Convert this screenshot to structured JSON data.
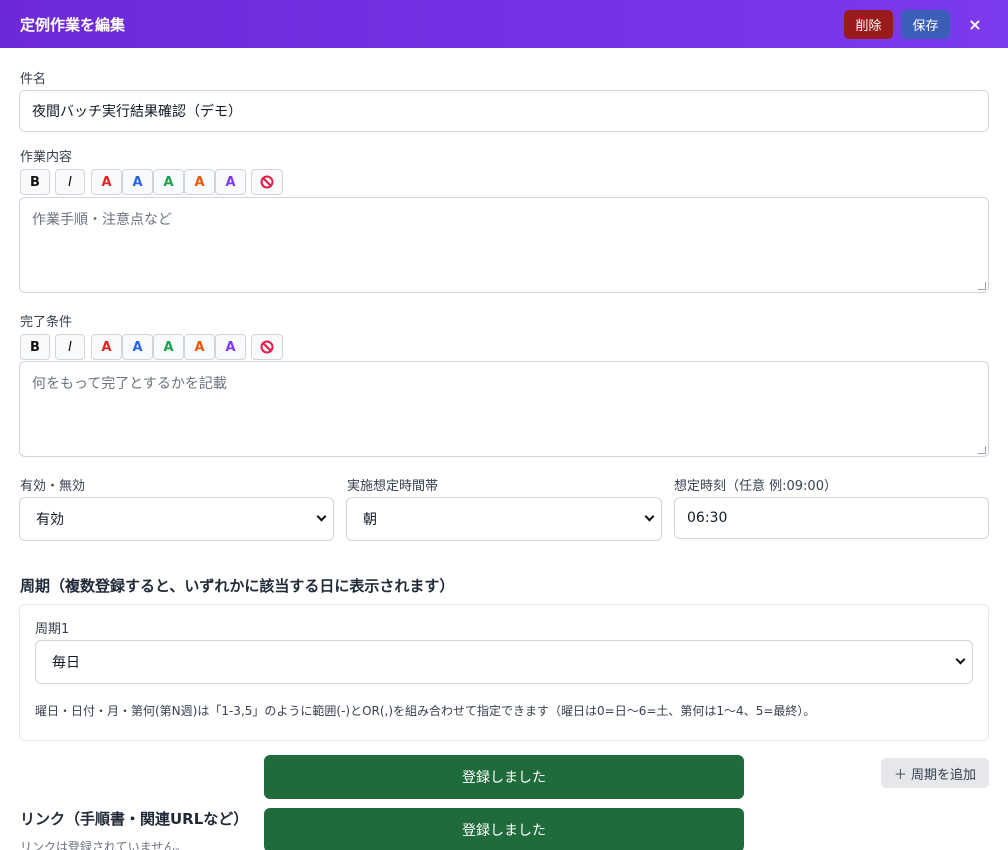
{
  "header": {
    "title": "定例作業を編集",
    "delete_label": "削除",
    "save_label": "保存",
    "close_label": "×"
  },
  "subject": {
    "label": "件名",
    "value": "夜間バッチ実行結果確認（デモ）"
  },
  "content": {
    "label": "作業内容",
    "placeholder": "作業手順・注意点など"
  },
  "completion": {
    "label": "完了条件",
    "placeholder": "何をもって完了とするかを記載"
  },
  "toolbar": {
    "bold": "B",
    "italic": "I",
    "color_a": "A",
    "colors": [
      "#dc2626",
      "#2563eb",
      "#16a34a",
      "#ea580c",
      "#7c3aed"
    ],
    "clear_icon": "prohibited-icon"
  },
  "status": {
    "label": "有効・無効",
    "value": "有効"
  },
  "timeslot": {
    "label": "実施想定時間帯",
    "value": "朝"
  },
  "time": {
    "label": "想定時刻（任意 例:09:00）",
    "value": "06:30"
  },
  "cycle": {
    "section_title": "周期（複数登録すると、いずれかに該当する日に表示されます）",
    "item_label": "周期1",
    "item_value": "毎日",
    "hint": "曜日・日付・月・第何(第N週)は「1-3,5」のように範囲(-)とOR(,)を組み合わせて指定できます（曜日は0=日〜6=土、第何は1〜4、5=最終）。",
    "add_label": "＋ 周期を追加"
  },
  "toasts": [
    "登録しました",
    "登録しました"
  ],
  "links": {
    "title": "リンク（手順書・関連URLなど）",
    "empty": "リンクは登録されていません。"
  }
}
